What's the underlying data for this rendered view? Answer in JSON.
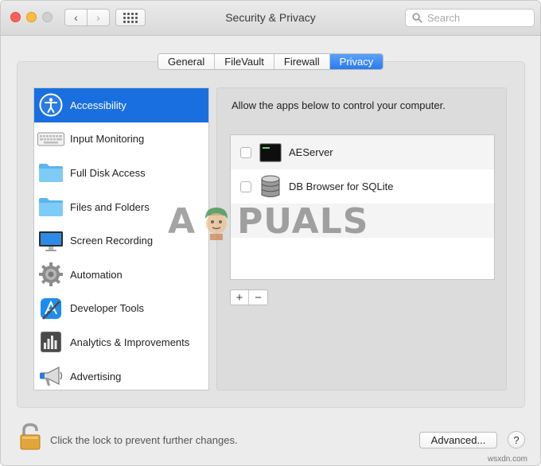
{
  "window": {
    "title": "Security & Privacy"
  },
  "toolbar": {
    "back": "‹",
    "forward": "›"
  },
  "search": {
    "placeholder": "Search"
  },
  "tabs": [
    {
      "label": "General",
      "active": false
    },
    {
      "label": "FileVault",
      "active": false
    },
    {
      "label": "Firewall",
      "active": false
    },
    {
      "label": "Privacy",
      "active": true
    }
  ],
  "sidebar": {
    "items": [
      {
        "label": "Accessibility",
        "icon": "accessibility-icon",
        "selected": true
      },
      {
        "label": "Input Monitoring",
        "icon": "keyboard-icon"
      },
      {
        "label": "Full Disk Access",
        "icon": "folder-icon"
      },
      {
        "label": "Files and Folders",
        "icon": "folder-icon"
      },
      {
        "label": "Screen Recording",
        "icon": "monitor-icon"
      },
      {
        "label": "Automation",
        "icon": "gear-icon"
      },
      {
        "label": "Developer Tools",
        "icon": "developer-tools-icon"
      },
      {
        "label": "Analytics & Improvements",
        "icon": "analytics-icon"
      },
      {
        "label": "Advertising",
        "icon": "megaphone-icon"
      }
    ]
  },
  "main": {
    "description": "Allow the apps below to control your computer.",
    "apps": [
      {
        "name": "AEServer",
        "icon": "terminal-icon",
        "checked": false
      },
      {
        "name": "DB Browser for SQLite",
        "icon": "database-icon",
        "checked": false
      }
    ],
    "add_label": "+",
    "remove_label": "−"
  },
  "watermark": {
    "left": "A",
    "right": "PUALS"
  },
  "footer": {
    "lock_text": "Click the lock to prevent further changes.",
    "advanced_label": "Advanced...",
    "help_label": "?",
    "source": "wsxdn.com"
  },
  "colors": {
    "accent": "#1a6fe0",
    "tab_active": "#2b7bf0",
    "close": "#fc605c",
    "minimize": "#fdbc40"
  }
}
